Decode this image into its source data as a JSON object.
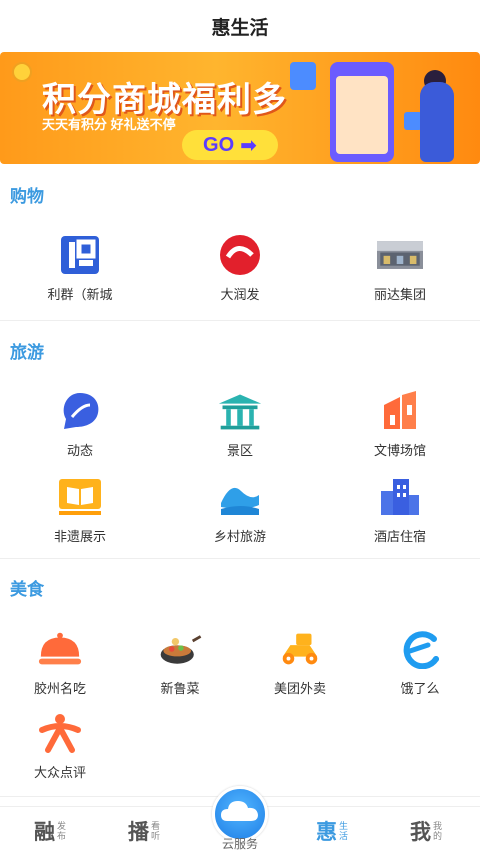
{
  "header": {
    "title": "惠生活"
  },
  "banner": {
    "title": "积分商城福利多",
    "subtitle": "天天有积分  好礼送不停",
    "cta": "GO"
  },
  "sections": {
    "shopping": {
      "title": "购物",
      "items": [
        {
          "label": "利群（新城",
          "icon": "liqun-logo-icon"
        },
        {
          "label": "大润发",
          "icon": "rt-mart-logo-icon"
        },
        {
          "label": "丽达集团",
          "icon": "storefront-photo-icon"
        }
      ]
    },
    "travel": {
      "title": "旅游",
      "items": [
        {
          "label": "动态",
          "icon": "leaf-bubble-icon"
        },
        {
          "label": "景区",
          "icon": "pavilion-icon"
        },
        {
          "label": "文博场馆",
          "icon": "building-icon"
        },
        {
          "label": "非遗展示",
          "icon": "book-icon"
        },
        {
          "label": "乡村旅游",
          "icon": "mountain-icon"
        },
        {
          "label": "酒店住宿",
          "icon": "hotel-icon"
        }
      ]
    },
    "food": {
      "title": "美食",
      "items": [
        {
          "label": "胶州名吃",
          "icon": "food-cloche-icon"
        },
        {
          "label": "新鲁菜",
          "icon": "wok-icon"
        },
        {
          "label": "美团外卖",
          "icon": "scooter-icon"
        },
        {
          "label": "饿了么",
          "icon": "eleme-logo-icon"
        },
        {
          "label": "大众点评",
          "icon": "dianping-logo-icon"
        }
      ]
    }
  },
  "tabbar": {
    "tabs": [
      {
        "big": "融",
        "small": "发布",
        "active": false
      },
      {
        "big": "播",
        "small": "看听",
        "active": false
      },
      {
        "big": "惠",
        "small": "生活",
        "active": true
      },
      {
        "big": "我",
        "small": "我的",
        "active": false
      }
    ],
    "center_label": "云服务"
  },
  "colors": {
    "accent": "#3c9ae0",
    "banner": "#ffa726"
  }
}
